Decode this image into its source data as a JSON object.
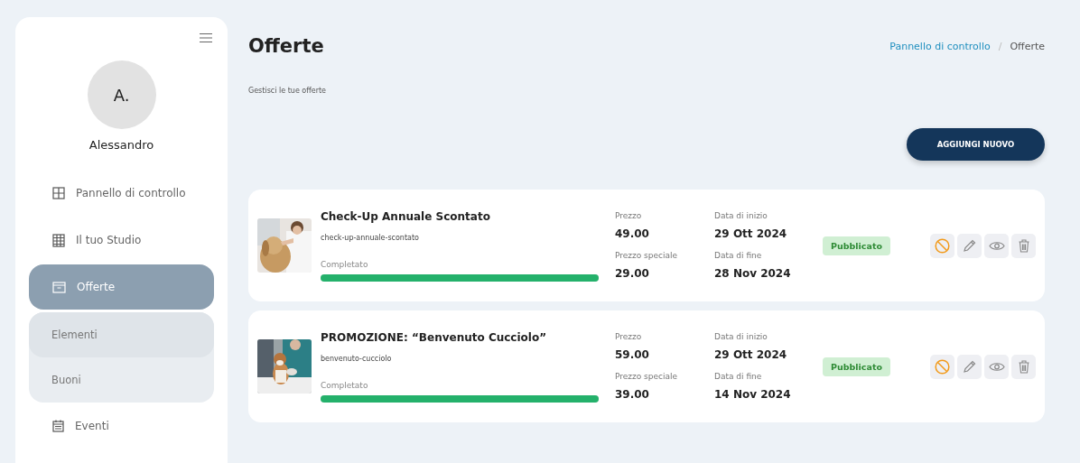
{
  "sidebar": {
    "avatar_initials": "A.",
    "user_name": "Alessandro",
    "items": [
      {
        "label": "Pannello di controllo",
        "selected": false
      },
      {
        "label": "Il tuo Studio",
        "selected": false
      },
      {
        "label": "Offerte",
        "selected": true,
        "expanded": true,
        "children": [
          {
            "label": "Elementi",
            "selected": true
          },
          {
            "label": "Buoni",
            "selected": false
          }
        ]
      },
      {
        "label": "Eventi",
        "selected": false
      }
    ]
  },
  "header": {
    "title": "Offerte",
    "subtitle": "Gestisci le tue offerte",
    "breadcrumb_separator": "/",
    "breadcrumb": [
      {
        "label": "Pannello di controllo",
        "kind": "link"
      },
      {
        "label": "Offerte",
        "kind": "current"
      }
    ],
    "add_button": "AGGIUNGI NUOVO"
  },
  "offers": [
    {
      "title": "Check-Up Annuale Scontato",
      "slug": "check-up-annuale-scontato",
      "progress_label": "Completato",
      "level": 1,
      "price_label": "Prezzo",
      "price": "49.00",
      "special_label": "Prezzo speciale",
      "special_price": "29.00",
      "start_label": "Data di inizio",
      "start_date": "29 Ott 2024",
      "end_label": "Data di fine",
      "end_date": "28 Nov 2024",
      "status": "Pubblicato"
    },
    {
      "title": "PROMOZIONE: “Benvenuto Cucciolo”",
      "slug": "benvenuto-cucciolo",
      "progress_label": "Completato",
      "level": 1,
      "price_label": "Prezzo",
      "price": "59.00",
      "special_label": "Prezzo speciale",
      "special_price": "39.00",
      "start_label": "Data di inizio",
      "start_date": "29 Ott 2024",
      "end_label": "Data di fine",
      "end_date": "14 Nov 2024",
      "status": "Pubblicato"
    }
  ]
}
